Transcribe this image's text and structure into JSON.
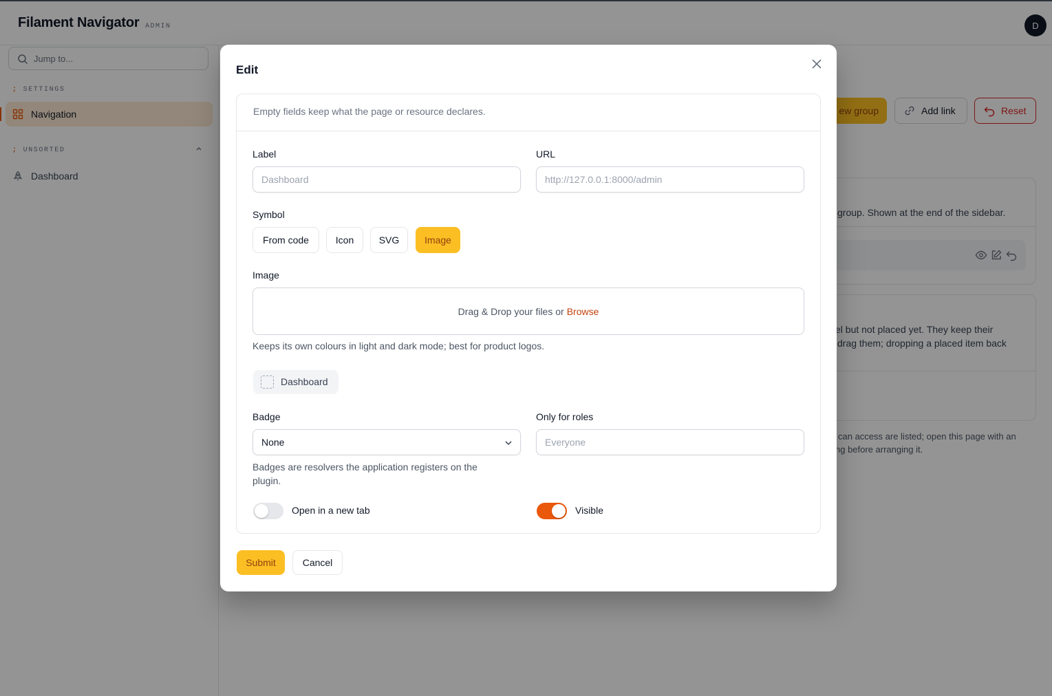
{
  "app": {
    "name": "Filament Navigator",
    "tag": "ADMIN",
    "avatar_initial": "D"
  },
  "sidebar": {
    "search_placeholder": "Jump to...",
    "groups": [
      {
        "label": "SETTINGS",
        "items": [
          {
            "label": "Navigation",
            "icon": "grid-icon",
            "active": true
          }
        ]
      },
      {
        "label": "UNSORTED",
        "collapsible": true,
        "items": [
          {
            "label": "Dashboard",
            "icon": "rocket-icon",
            "active": false
          }
        ]
      }
    ]
  },
  "background": {
    "actions": {
      "new_group": "ew group",
      "add_link": "Add link",
      "reset": "Reset"
    },
    "card1_text": "group. Shown at the end of the sidebar.",
    "card2_line1": "el but not placed yet. They keep their",
    "card2_line2": "drag them; dropping a placed item back",
    "footer_line1": "can access are listed; open this page with an",
    "footer_line2": "ng before arranging it."
  },
  "modal": {
    "title": "Edit",
    "description": "Empty fields keep what the page or resource declares.",
    "label_field": {
      "label": "Label",
      "placeholder": "Dashboard"
    },
    "url_field": {
      "label": "URL",
      "placeholder": "http://127.0.0.1:8000/admin"
    },
    "symbol": {
      "label": "Symbol",
      "options": [
        "From code",
        "Icon",
        "SVG",
        "Image"
      ],
      "selected": "Image"
    },
    "image": {
      "label": "Image",
      "drop_text": "Drag & Drop your files or",
      "browse": "Browse",
      "help": "Keeps its own colours in light and dark mode; best for product logos."
    },
    "preview_label": "Dashboard",
    "badge": {
      "label": "Badge",
      "value": "None",
      "help_line1": "Badges are resolvers the application registers on the",
      "help_line2": "plugin."
    },
    "roles": {
      "label": "Only for roles",
      "placeholder": "Everyone"
    },
    "new_tab": {
      "label": "Open in a new tab",
      "on": false
    },
    "visible": {
      "label": "Visible",
      "on": true
    },
    "submit": "Submit",
    "cancel": "Cancel"
  },
  "colors": {
    "primary": "#fbbf24",
    "accent": "#ea580c",
    "danger": "#dc2626"
  }
}
